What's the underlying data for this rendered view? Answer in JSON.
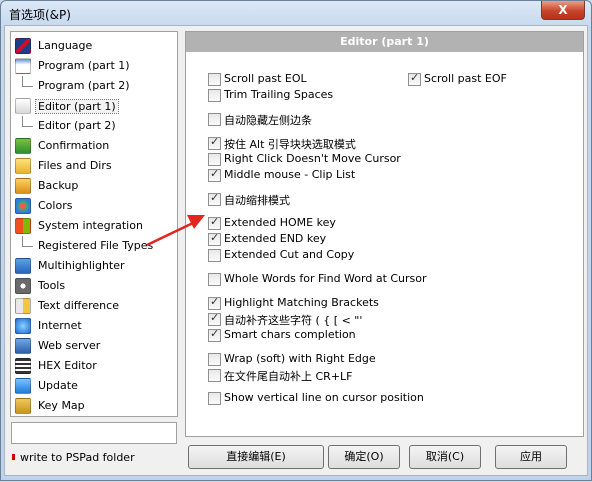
{
  "window": {
    "title": "首选项(&P)",
    "close_glyph": "X"
  },
  "sidebar": {
    "items": [
      {
        "label": "Language",
        "icon": "uk-flag-icon"
      },
      {
        "label": "Program  (part 1)",
        "icon": "program-icon"
      },
      {
        "label": "Program  (part 2)",
        "icon": "tree-line"
      },
      {
        "label": "Editor  (part 1)",
        "icon": "editor-icon",
        "selected": true
      },
      {
        "label": "Editor  (part 2)",
        "icon": "tree-line"
      },
      {
        "label": "Confirmation",
        "icon": "confirmation-icon"
      },
      {
        "label": "Files and Dirs",
        "icon": "folder-icon"
      },
      {
        "label": "Backup",
        "icon": "backup-icon"
      },
      {
        "label": "Colors",
        "icon": "palette-icon"
      },
      {
        "label": "System integration",
        "icon": "windows-icon"
      },
      {
        "label": "Registered File Types",
        "icon": "tree-line"
      },
      {
        "label": "Multihighlighter",
        "icon": "highlighter-icon"
      },
      {
        "label": "Tools",
        "icon": "gear-icon"
      },
      {
        "label": "Text difference",
        "icon": "diff-icon"
      },
      {
        "label": "Internet",
        "icon": "globe-icon"
      },
      {
        "label": "Web server",
        "icon": "server-icon"
      },
      {
        "label": "HEX Editor",
        "icon": "hex-icon"
      },
      {
        "label": "Update",
        "icon": "update-icon"
      },
      {
        "label": "Key Map",
        "icon": "keyboard-icon"
      }
    ],
    "input_value": "",
    "write_folder_label": "write to PSPad folder"
  },
  "panel": {
    "title": "Editor  (part 1)",
    "options": [
      {
        "label": "Scroll past EOL",
        "checked": false
      },
      {
        "label": "Scroll past EOF",
        "checked": true
      },
      {
        "label": "Trim Trailing Spaces",
        "checked": false
      },
      {
        "label": "自动隐藏左侧边条",
        "checked": false
      },
      {
        "label": "按住 Alt 引导块块选取模式",
        "checked": true
      },
      {
        "label": "Right Click Doesn't Move Cursor",
        "checked": false
      },
      {
        "label": "Middle mouse - Clip List",
        "checked": true
      },
      {
        "label": "自动缩排模式",
        "checked": true
      },
      {
        "label": "Extended HOME key",
        "checked": true
      },
      {
        "label": "Extended END key",
        "checked": true
      },
      {
        "label": "Extended Cut and Copy",
        "checked": false
      },
      {
        "label": "Whole Words for Find Word at Cursor",
        "checked": false
      },
      {
        "label": "Highlight Matching Brackets",
        "checked": true
      },
      {
        "label": "自动补齐这些字符 ( { [ < \"'",
        "checked": true
      },
      {
        "label": "Smart chars completion",
        "checked": true
      },
      {
        "label": "Wrap (soft) with Right Edge",
        "checked": false
      },
      {
        "label": "在文件尾自动补上 CR+LF",
        "checked": false
      },
      {
        "label": "Show vertical line on cursor position",
        "checked": false
      }
    ]
  },
  "buttons": {
    "edit": "直接编辑(E)",
    "ok": "确定(O)",
    "cancel": "取消(C)",
    "apply": "应用"
  },
  "colors": {
    "arrow": "#e0261e",
    "header": "#b2b2b2"
  }
}
